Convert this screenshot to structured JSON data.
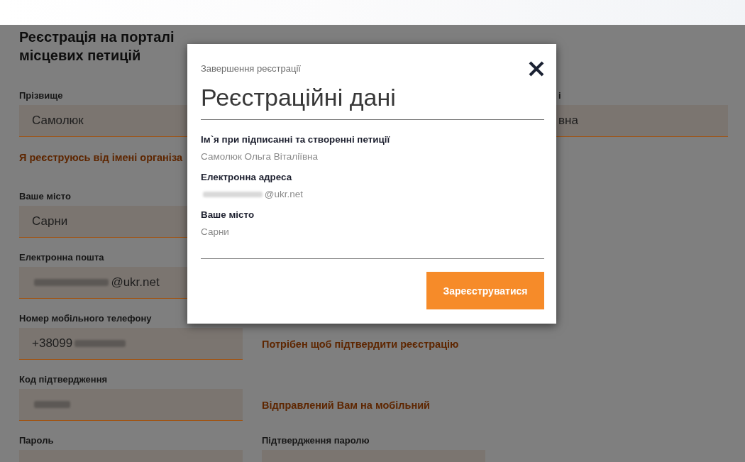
{
  "page": {
    "title": "Реєстрація на порталі місцевих петицій"
  },
  "name_row": {
    "surname": {
      "label": "Прізвище",
      "value": [
        {
          "kind": "text",
          "text": "Самолюк"
        }
      ]
    },
    "column_3": {
      "label": "і",
      "value": [
        {
          "kind": "text",
          "text": "вна"
        }
      ]
    }
  },
  "organization_link": "Я реєструюсь від імені організа",
  "rows": [
    [
      {
        "kind": "field",
        "label": "Ваше місто",
        "value": [
          {
            "kind": "text",
            "text": "Сарни"
          }
        ]
      }
    ],
    [
      {
        "kind": "field",
        "label": "Електронна пошта",
        "value": [
          {
            "kind": "blur"
          },
          {
            "kind": "text",
            "text": "@ukr.net"
          }
        ]
      }
    ],
    [
      {
        "kind": "field",
        "label": "Номер мобільного телефону",
        "value": [
          {
            "kind": "text",
            "text": "+38099"
          },
          {
            "kind": "blur"
          }
        ]
      },
      {
        "kind": "note",
        "text": "Потрібен щоб підтвердити реєстрацію"
      }
    ],
    [
      {
        "kind": "field",
        "label": "Код підтвердження",
        "value": [
          {
            "kind": "blur"
          }
        ]
      },
      {
        "kind": "note",
        "text": "Відправлений Вам на мобільний"
      }
    ],
    [
      {
        "kind": "field",
        "label": "Пароль"
      },
      {
        "kind": "field",
        "label": "Підтвердження паролю"
      }
    ]
  ],
  "modal": {
    "subtitle": "Завершення реєстрації",
    "title": "Реєстраційні дані",
    "items": [
      {
        "label": "Ім`я при підписанні та створенні петиції",
        "value": [
          {
            "kind": "text",
            "text": "Самолюк Ольга Віталіївна"
          }
        ]
      },
      {
        "label": "Електронна адреса",
        "value": [
          {
            "kind": "blur"
          },
          {
            "kind": "text",
            "text": "@ukr.net"
          }
        ]
      },
      {
        "label": "Ваше місто",
        "value": [
          {
            "kind": "text",
            "text": "Сарни"
          }
        ]
      }
    ],
    "submit_button": "Зареєструватися"
  }
}
